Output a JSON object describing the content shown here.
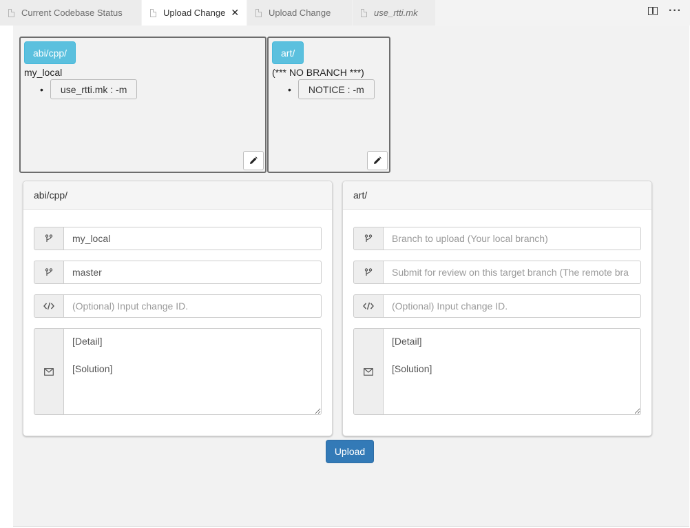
{
  "tabs": [
    {
      "label": "Current Codebase Status",
      "active": false
    },
    {
      "label": "Upload Change",
      "active": true
    },
    {
      "label": "Upload Change",
      "active": false
    },
    {
      "label": "use_rtti.mk",
      "active": false,
      "italic": true
    }
  ],
  "tab_close_glyph": "✕",
  "tabbar_actions": {
    "split_icon": "split-editor-icon",
    "more_label": "···"
  },
  "summaries": [
    {
      "repo": "abi/cpp/",
      "branch": "my_local",
      "files": [
        "use_rtti.mk : -m"
      ]
    },
    {
      "repo": "art/",
      "branch": "(*** NO BRANCH ***)",
      "files": [
        "NOTICE : -m"
      ]
    }
  ],
  "panels": [
    {
      "title": "abi/cpp/",
      "local_branch": {
        "value": "my_local",
        "placeholder": "Branch to upload (Your local branch)"
      },
      "target_branch": {
        "value": "master",
        "placeholder": "Submit for review on this target branch (The remote branch)"
      },
      "change_id": {
        "value": "",
        "placeholder": "(Optional) Input change ID."
      },
      "message": "[Detail]\n\n[Solution]"
    },
    {
      "title": "art/",
      "local_branch": {
        "value": "",
        "placeholder": "Branch to upload (Your local branch)"
      },
      "target_branch": {
        "value": "",
        "placeholder": "Submit for review on this target branch (The remote bra"
      },
      "change_id": {
        "value": "",
        "placeholder": "(Optional) Input change ID."
      },
      "message": "[Detail]\n\n[Solution]"
    }
  ],
  "upload_label": "Upload",
  "colors": {
    "badge": "#5bc0de",
    "primary": "#337ab7",
    "content_bg": "#f2f2f2"
  }
}
